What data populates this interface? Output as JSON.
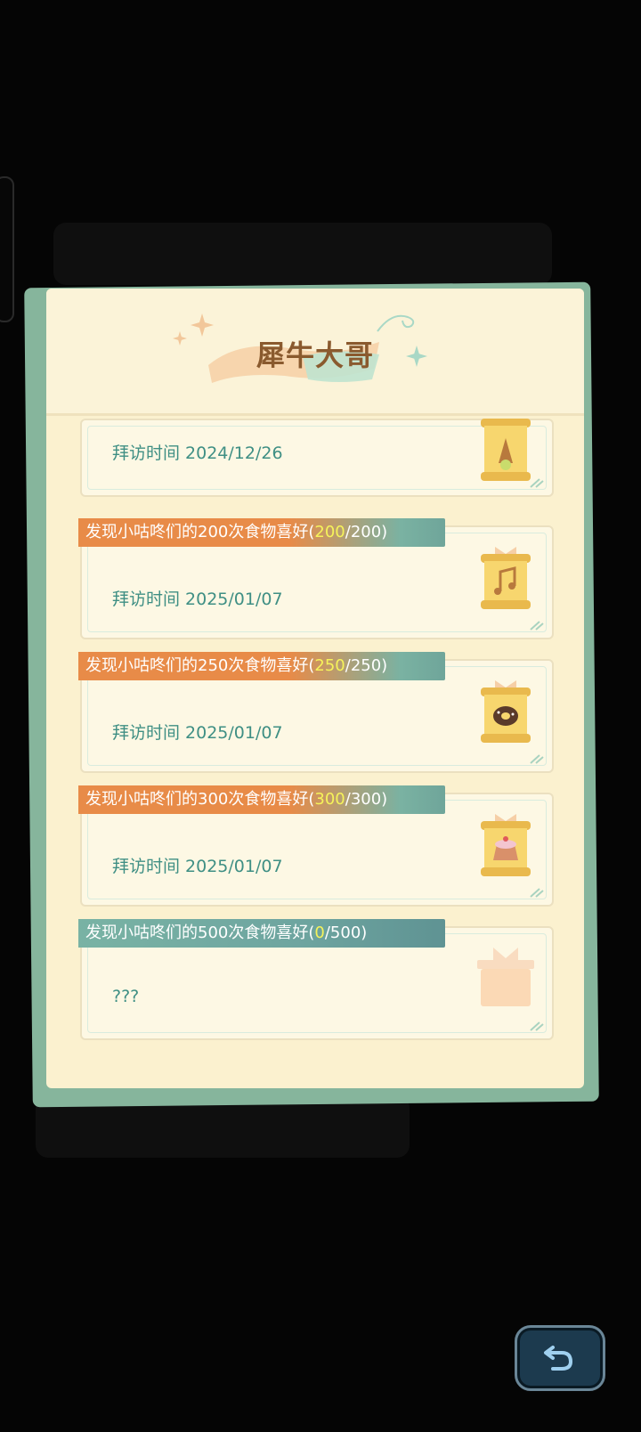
{
  "panel": {
    "title": "犀牛大哥"
  },
  "cards": [
    {
      "ribbon_pre": "",
      "ribbon_hl": "",
      "ribbon_post": "",
      "visit": "拜访时间 2024/12/26",
      "icon": "scroll-ice-cream-icon"
    },
    {
      "ribbon_pre": "发现小咕咚们的200次食物喜好(",
      "ribbon_hl": "200",
      "ribbon_post": "/200)",
      "visit": "拜访时间 2025/01/07",
      "icon": "scroll-music-note-icon"
    },
    {
      "ribbon_pre": "发现小咕咚们的250次食物喜好(",
      "ribbon_hl": "250",
      "ribbon_post": "/250)",
      "visit": "拜访时间 2025/01/07",
      "icon": "scroll-donut-icon"
    },
    {
      "ribbon_pre": "发现小咕咚们的300次食物喜好(",
      "ribbon_hl": "300",
      "ribbon_post": "/300)",
      "visit": "拜访时间 2025/01/07",
      "icon": "scroll-cake-icon"
    },
    {
      "ribbon_pre": "发现小咕咚们的500次食物喜好(",
      "ribbon_hl": "0",
      "ribbon_post": "/500)",
      "visit": "???",
      "icon": "locked-gift-icon"
    }
  ],
  "colors": {
    "ribbon_done": "#e88b48",
    "ribbon_locked": "#6fa59a",
    "highlight": "#f6f35a",
    "visit_text": "#3f8f84",
    "title_text": "#8a5a2e"
  },
  "back_button": {
    "icon": "undo-arrow-icon"
  }
}
